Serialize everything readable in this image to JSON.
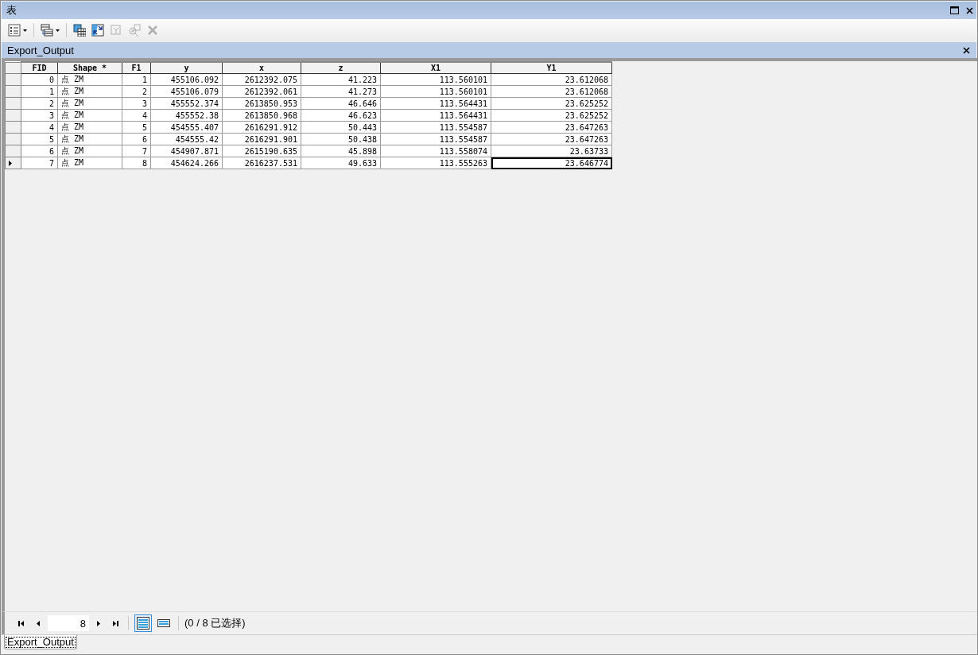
{
  "window": {
    "title": "表"
  },
  "toolbar": [
    {
      "kind": "menu",
      "disabled": false
    },
    {
      "kind": "menu",
      "disabled": false
    },
    {
      "kind": "button",
      "disabled": false
    },
    {
      "kind": "button",
      "disabled": false
    },
    {
      "kind": "button",
      "disabled": true
    },
    {
      "kind": "button",
      "disabled": true
    },
    {
      "kind": "button",
      "disabled": true
    }
  ],
  "table_title": "Export_Output",
  "table": {
    "columns": [
      "FID",
      "Shape *",
      "F1",
      "y",
      "x",
      "z",
      "X1",
      "Y1"
    ],
    "rows": [
      {
        "current": false,
        "cells": [
          "0",
          "点 ZM",
          "1",
          "455106.092",
          "2612392.075",
          "41.223",
          "113.560101",
          "23.612068"
        ]
      },
      {
        "current": false,
        "cells": [
          "1",
          "点 ZM",
          "2",
          "455106.079",
          "2612392.061",
          "41.273",
          "113.560101",
          "23.612068"
        ]
      },
      {
        "current": false,
        "cells": [
          "2",
          "点 ZM",
          "3",
          "455552.374",
          "2613850.953",
          "46.646",
          "113.564431",
          "23.625252"
        ]
      },
      {
        "current": false,
        "cells": [
          "3",
          "点 ZM",
          "4",
          "455552.38",
          "2613850.968",
          "46.623",
          "113.564431",
          "23.625252"
        ]
      },
      {
        "current": false,
        "cells": [
          "4",
          "点 ZM",
          "5",
          "454555.407",
          "2616291.912",
          "50.443",
          "113.554587",
          "23.647263"
        ]
      },
      {
        "current": false,
        "cells": [
          "5",
          "点 ZM",
          "6",
          "454555.42",
          "2616291.901",
          "50.438",
          "113.554587",
          "23.647263"
        ]
      },
      {
        "current": false,
        "cells": [
          "6",
          "点 ZM",
          "7",
          "454907.871",
          "2615190.635",
          "45.898",
          "113.558074",
          "23.63733"
        ]
      },
      {
        "current": true,
        "cells": [
          "7",
          "点 ZM",
          "8",
          "454624.266",
          "2616237.531",
          "49.633",
          "113.555263",
          "23.646774"
        ]
      }
    ]
  },
  "navigator": {
    "record": "8",
    "views": [
      {
        "selected": true
      },
      {
        "selected": false
      }
    ],
    "selection_status": "(0 / 8 已选择)"
  },
  "tabs": [
    {
      "label": "Export_Output",
      "selected": true
    }
  ]
}
